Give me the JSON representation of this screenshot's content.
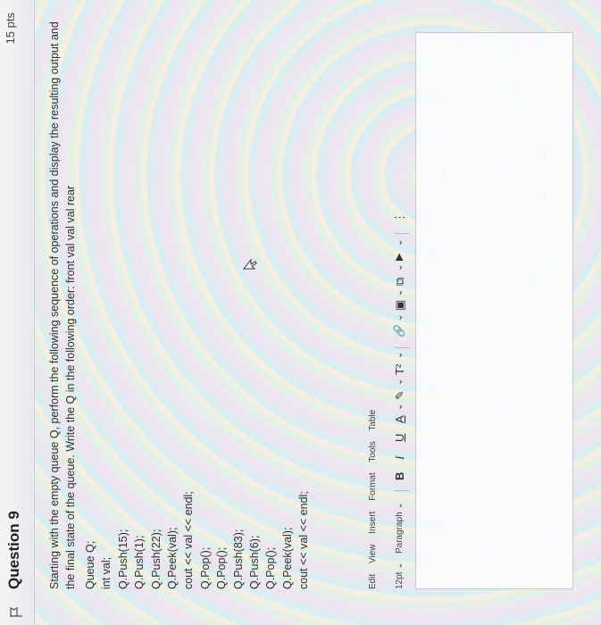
{
  "question": {
    "title": "Question 9",
    "points": "15 pts"
  },
  "prompt_text": "Starting with the empty queue Q, perform the following sequence of operations and display the resulting output and the final state of the queue. Write the Q in the following order: front val val val rear",
  "code_lines": [
    "Queue Q;",
    "int val;",
    "Q.Push(15);",
    "Q.Push(1);",
    "Q.Push(22);",
    "Q.Peek(val);",
    "cout << val << endl;",
    "Q.Pop();",
    "Q.Pop();",
    "Q.Push(83);",
    "Q.Push(6);",
    "Q.Pop();",
    "Q.Peek(val);",
    "cout << val << endl;"
  ],
  "menubar": {
    "edit": "Edit",
    "view": "View",
    "insert": "Insert",
    "format": "Format",
    "tools": "Tools",
    "table": "Table"
  },
  "toolbar": {
    "font_size": "12pt",
    "paragraph": "Paragraph",
    "bold": "B",
    "italic": "I",
    "underline": "U",
    "text_color": "A",
    "highlight": "✎",
    "superscript": "T²",
    "link": "🔗",
    "image": "▣",
    "embed": "⧉",
    "media": "▶",
    "more": "⋮"
  }
}
